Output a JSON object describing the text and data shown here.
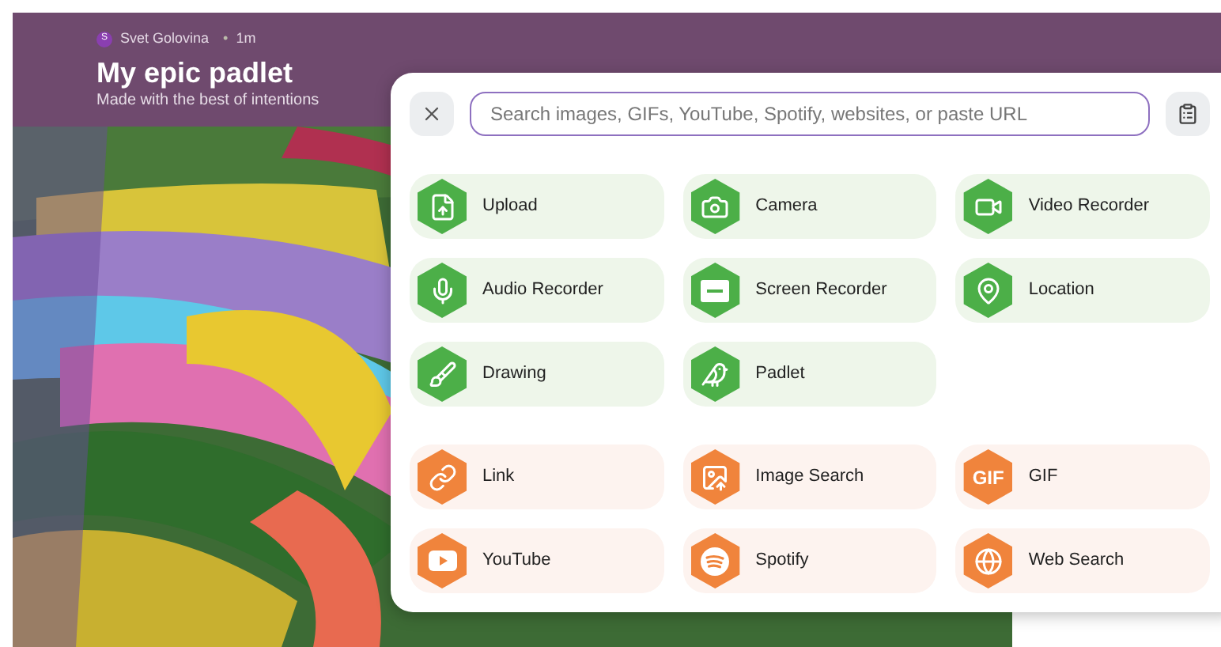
{
  "header": {
    "avatar": "S",
    "author": "Svet Golovina",
    "separator": "•",
    "time": "1m",
    "title": "My epic padlet",
    "subtitle": "Made with the best of intentions"
  },
  "picker": {
    "search": {
      "placeholder": "Search images, GIFs, YouTube, Spotify, websites, or paste URL"
    },
    "sections": [
      {
        "kind": "create",
        "items": [
          {
            "label": "Upload"
          },
          {
            "label": "Camera"
          },
          {
            "label": "Video Recorder"
          },
          {
            "label": "Audio Recorder"
          },
          {
            "label": "Screen Recorder"
          },
          {
            "label": "Location"
          },
          {
            "label": "Drawing"
          },
          {
            "label": "Padlet"
          }
        ]
      },
      {
        "kind": "link",
        "items": [
          {
            "label": "Link"
          },
          {
            "label": "Image Search"
          },
          {
            "label": "GIF",
            "icon_text": "GIF"
          },
          {
            "label": "YouTube"
          },
          {
            "label": "Spotify"
          },
          {
            "label": "Web Search"
          }
        ]
      }
    ]
  }
}
